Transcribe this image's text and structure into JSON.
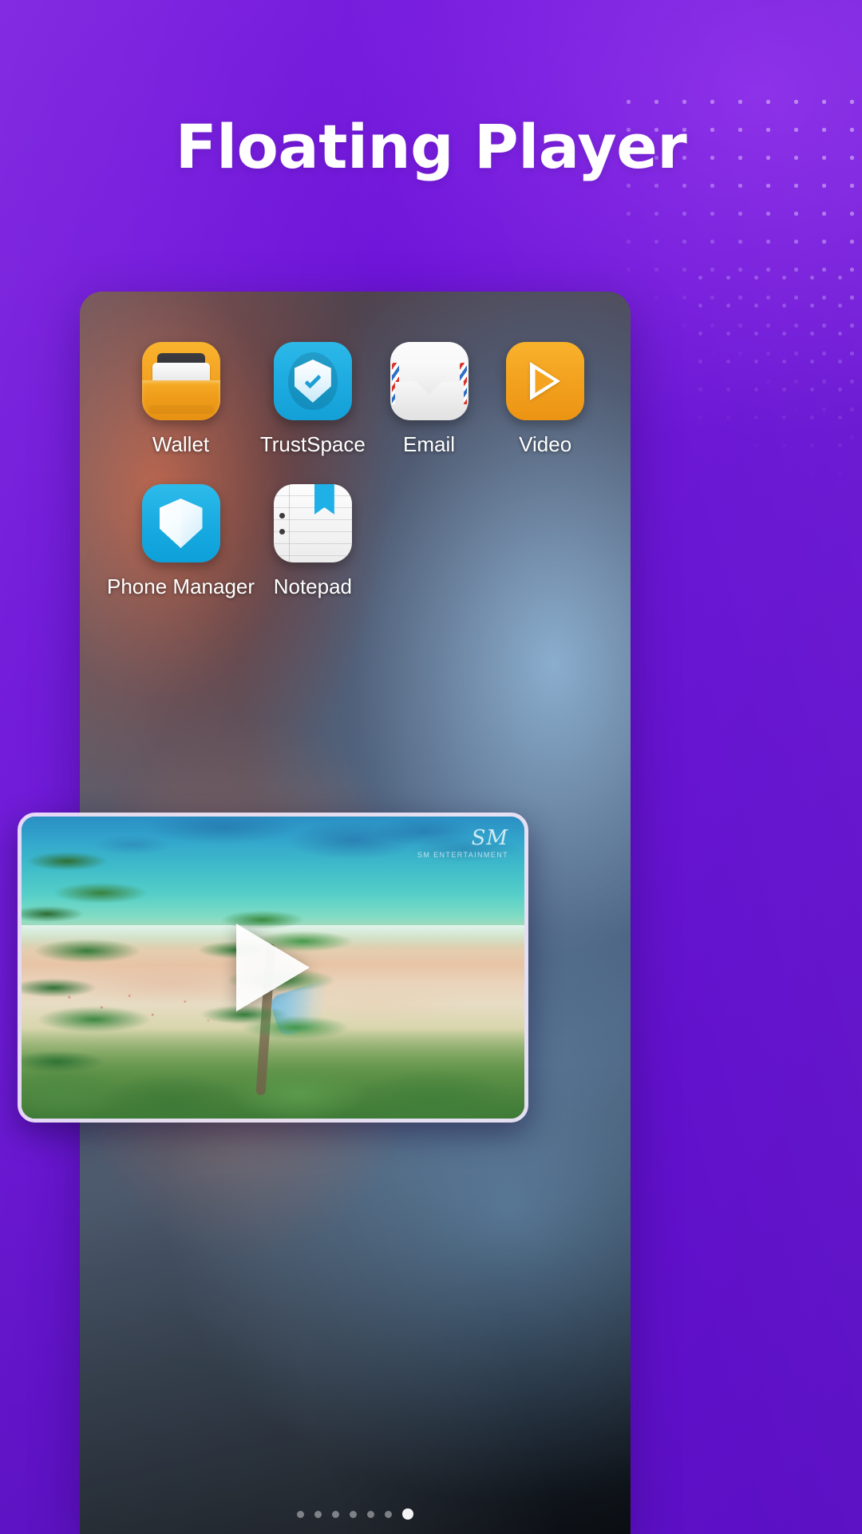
{
  "promo": {
    "headline": "Floating Player",
    "accent_color": "#6b14d6",
    "headline_color": "#ffffff"
  },
  "device": {
    "home_screen": {
      "apps": [
        {
          "label": "Wallet",
          "icon": "wallet-icon",
          "color": "#f2a020"
        },
        {
          "label": "TrustSpace",
          "icon": "shield-check-icon",
          "color": "#1ba9df"
        },
        {
          "label": "Email",
          "icon": "envelope-icon",
          "color": "#f1f1f1"
        },
        {
          "label": "Video",
          "icon": "play-triangle-icon",
          "color": "#f2a01d"
        },
        {
          "label": "Phone Manager",
          "icon": "shield-icon",
          "color": "#16a9e0"
        },
        {
          "label": "Notepad",
          "icon": "notepad-icon",
          "color": "#ececec"
        }
      ]
    },
    "page_indicator": {
      "total": 7,
      "active_index": 6
    }
  },
  "floating_player": {
    "play_icon": "play-icon",
    "watermark": {
      "mark": "SM",
      "subtitle": "SM ENTERTAINMENT"
    }
  }
}
